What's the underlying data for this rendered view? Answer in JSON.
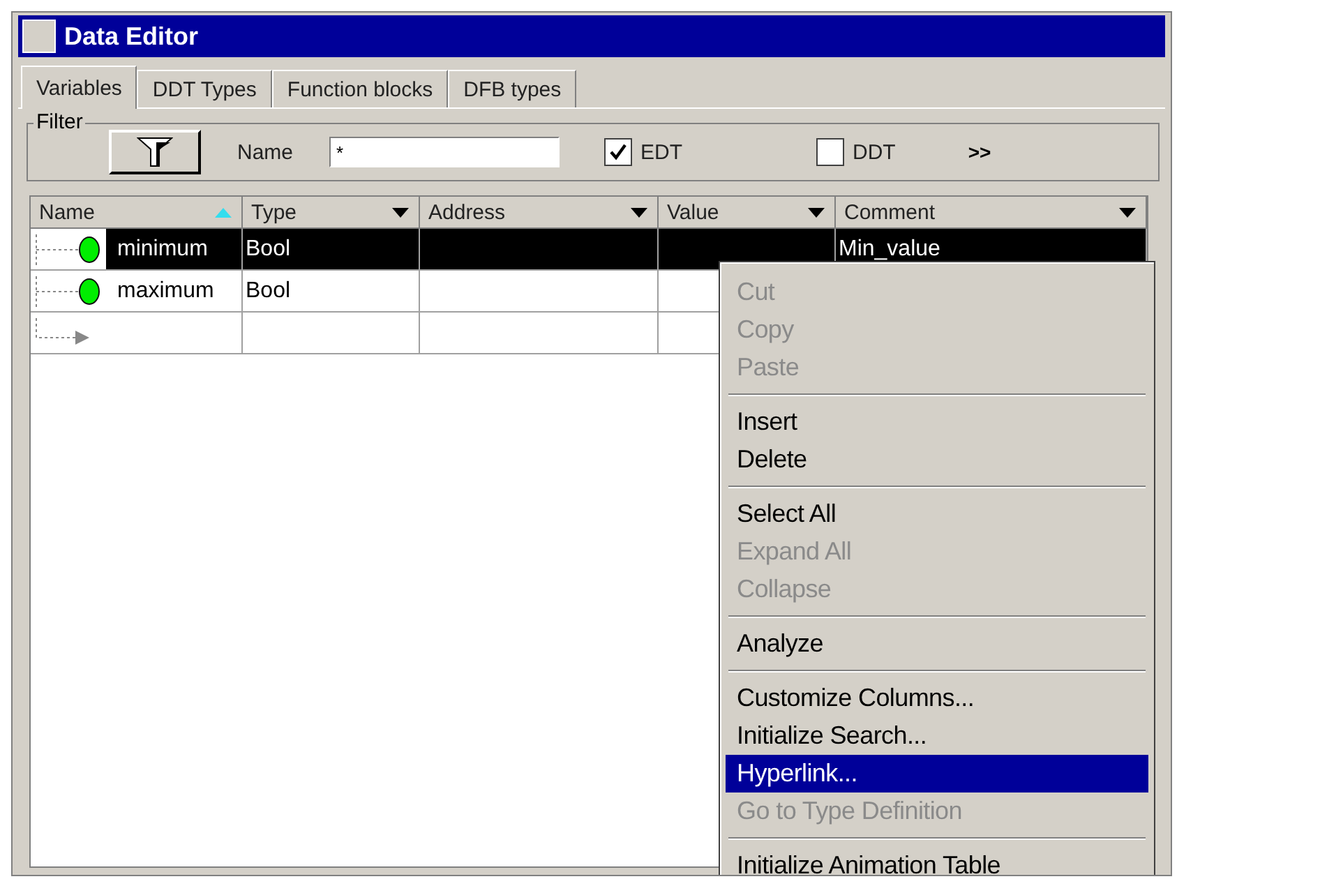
{
  "window": {
    "title": "Data Editor"
  },
  "tabs": [
    {
      "label": "Variables",
      "selected": true
    },
    {
      "label": "DDT Types",
      "selected": false
    },
    {
      "label": "Function blocks",
      "selected": false
    },
    {
      "label": "DFB types",
      "selected": false
    }
  ],
  "filter": {
    "label": "Filter",
    "name_label": "Name",
    "name_value": "*",
    "checkboxes": [
      {
        "label": "EDT",
        "checked": true
      },
      {
        "label": "DDT",
        "checked": false
      }
    ],
    "more_button": ">>"
  },
  "table": {
    "columns": [
      {
        "label": "Name",
        "sorted": true
      },
      {
        "label": "Type",
        "sorted": false
      },
      {
        "label": "Address",
        "sorted": false
      },
      {
        "label": "Value",
        "sorted": false
      },
      {
        "label": "Comment",
        "sorted": false
      }
    ],
    "rows": [
      {
        "kind": "variable",
        "selected": true,
        "cells": [
          "minimum",
          "Bool",
          "",
          "",
          "Min_value"
        ]
      },
      {
        "kind": "variable",
        "selected": false,
        "cells": [
          "maximum",
          "Bool",
          "",
          "",
          ""
        ]
      },
      {
        "kind": "new",
        "selected": false,
        "cells": [
          "",
          "",
          "",
          "",
          ""
        ]
      }
    ]
  },
  "context_menu": [
    [
      {
        "label": "Cut",
        "disabled": true,
        "selected": false
      },
      {
        "label": "Copy",
        "disabled": true,
        "selected": false
      },
      {
        "label": "Paste",
        "disabled": true,
        "selected": false
      }
    ],
    [
      {
        "label": "Insert",
        "disabled": false,
        "selected": false
      },
      {
        "label": "Delete",
        "disabled": false,
        "selected": false
      }
    ],
    [
      {
        "label": "Select All",
        "disabled": false,
        "selected": false
      },
      {
        "label": "Expand All",
        "disabled": true,
        "selected": false
      },
      {
        "label": "Collapse",
        "disabled": true,
        "selected": false
      }
    ],
    [
      {
        "label": "Analyze",
        "disabled": false,
        "selected": false
      }
    ],
    [
      {
        "label": "Customize Columns...",
        "disabled": false,
        "selected": false
      },
      {
        "label": "Initialize Search...",
        "disabled": false,
        "selected": false
      },
      {
        "label": "Hyperlink...",
        "disabled": false,
        "selected": true
      },
      {
        "label": "Go to Type Definition",
        "disabled": true,
        "selected": false
      }
    ],
    [
      {
        "label": "Initialize Animation Table",
        "disabled": false,
        "selected": false
      }
    ]
  ]
}
